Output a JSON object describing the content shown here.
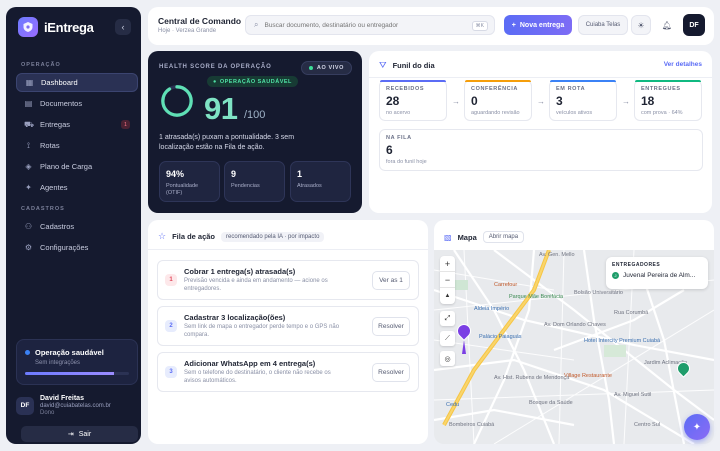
{
  "sidebar": {
    "brand": "iEntrega",
    "sections": {
      "operation": "OPERAÇÃO",
      "registry": "CADASTROS"
    },
    "items": [
      {
        "label": "Dashboard",
        "icon": "grid-icon"
      },
      {
        "label": "Documentos",
        "icon": "document-icon"
      },
      {
        "label": "Entregas",
        "icon": "truck-icon",
        "badge": "1"
      },
      {
        "label": "Rotas",
        "icon": "route-icon"
      },
      {
        "label": "Plano de Carga",
        "icon": "layers-icon"
      },
      {
        "label": "Agentes",
        "icon": "sparkle-icon"
      },
      {
        "label": "Cadastros",
        "icon": "users-icon"
      },
      {
        "label": "Configurações",
        "icon": "gear-icon"
      }
    ],
    "status": {
      "title": "Operação saudável",
      "subtitle": "Sem integrações",
      "progress": 0.86
    },
    "user": {
      "initials": "DF",
      "name": "David Freitas",
      "email": "david@cuiabatelas.com.br",
      "role": "Dono"
    },
    "logout": "Sair"
  },
  "header": {
    "title": "Central de Comando",
    "breadcrumb": "Hoje · Verzea Grande",
    "search_placeholder": "Buscar documento, destinatário ou entregador",
    "search_shortcut": "⌘K",
    "new_button": "Nova entrega",
    "tenant": "Cuiaba Telas",
    "avatar": "DF"
  },
  "health": {
    "label": "HEALTH SCORE DA OPERAÇÃO",
    "live": "AO VIVO",
    "status_pill": "OPERAÇÃO SAUDÁVEL",
    "score": "91",
    "score_max": "/100",
    "score_value": 91,
    "description": "1 atrasada(s) puxam a pontualidade. 3 sem localização estão na Fila de ação.",
    "kpis": [
      {
        "value": "94%",
        "label": "Pontualidade (OTIF)"
      },
      {
        "value": "9",
        "label": "Pendencias"
      },
      {
        "value": "1",
        "label": "Atrasados"
      }
    ]
  },
  "funnel": {
    "title": "Funil do dia",
    "link": "Ver detalhes",
    "stages": [
      {
        "label": "RECEBIDOS",
        "value": "28",
        "sub": "no acervo",
        "color": "#5b6cf5"
      },
      {
        "label": "CONFERÊNCIA",
        "value": "0",
        "sub": "aguardando revisão",
        "color": "#f59e0b"
      },
      {
        "label": "EM ROTA",
        "value": "3",
        "sub": "veículos ativos",
        "color": "#3b82f6"
      },
      {
        "label": "ENTREGUES",
        "value": "18",
        "sub": "com prova · 64%",
        "color": "#10b981"
      }
    ],
    "arrow": "→",
    "queue": {
      "label": "NA FILA",
      "value": "6",
      "sub": "fora do funil hoje"
    }
  },
  "action_queue": {
    "title": "Fila de ação",
    "tag": "recomendado pela IA · por impacto",
    "items": [
      {
        "num": "1",
        "title": "Cobrar 1 entrega(s) atrasada(s)",
        "desc": "Previsão vencida e ainda em andamento — acione os entregadores.",
        "button": "Ver as 1",
        "tone_bg": "#fde8ea",
        "tone_fg": "#e0475b"
      },
      {
        "num": "2",
        "title": "Cadastrar 3 localização(ões)",
        "desc": "Sem link de mapa o entregador perde tempo e o GPS não compara.",
        "button": "Resolver",
        "tone_bg": "#e7ecfd",
        "tone_fg": "#5b6cf5"
      },
      {
        "num": "3",
        "title": "Adicionar WhatsApp em 4 entrega(s)",
        "desc": "Sem o telefone do destinatário, o cliente não recebe os avisos automáticos.",
        "button": "Resolver",
        "tone_bg": "#e7ecfd",
        "tone_fg": "#5b6cf5"
      }
    ]
  },
  "map": {
    "title": "Mapa",
    "open_button": "Abrir mapa",
    "zoom_in": "+",
    "zoom_out": "−",
    "north": "▲",
    "drivers_title": "ENTREGADORES",
    "driver": {
      "initial": "J",
      "name": "Juvenal Pereira de Alm..."
    },
    "labels": {
      "street_a": "Av. Gen. Mello",
      "street_b": "Av. Dom Orlando Chaves",
      "poi_carrefour": "Carrefour",
      "poi_aldeia": "Aldeia Império",
      "poi_gov": "Palácio Paiaguás",
      "poi_bolsao": "Bolsão Universitário",
      "poi_hotel": "Hotel Intercity Premium Cuiabá",
      "poi_village": "Village Restaurante",
      "street_c": "Rua Corumbá",
      "street_d": "Av. Hist. Rubens de Mendonça",
      "street_e": "Av. Miguel Sutil",
      "district_a": "Bosque da Saúde",
      "district_b": "Centro Sul",
      "poi_cedu": "Cedu",
      "poi_fire": "Bombeiros Cuiabá",
      "poi_park": "Parque Mãe Bonifácia",
      "poi_jd": "Jardim Aclimação"
    }
  },
  "fab_icon": "sparkle-icon"
}
